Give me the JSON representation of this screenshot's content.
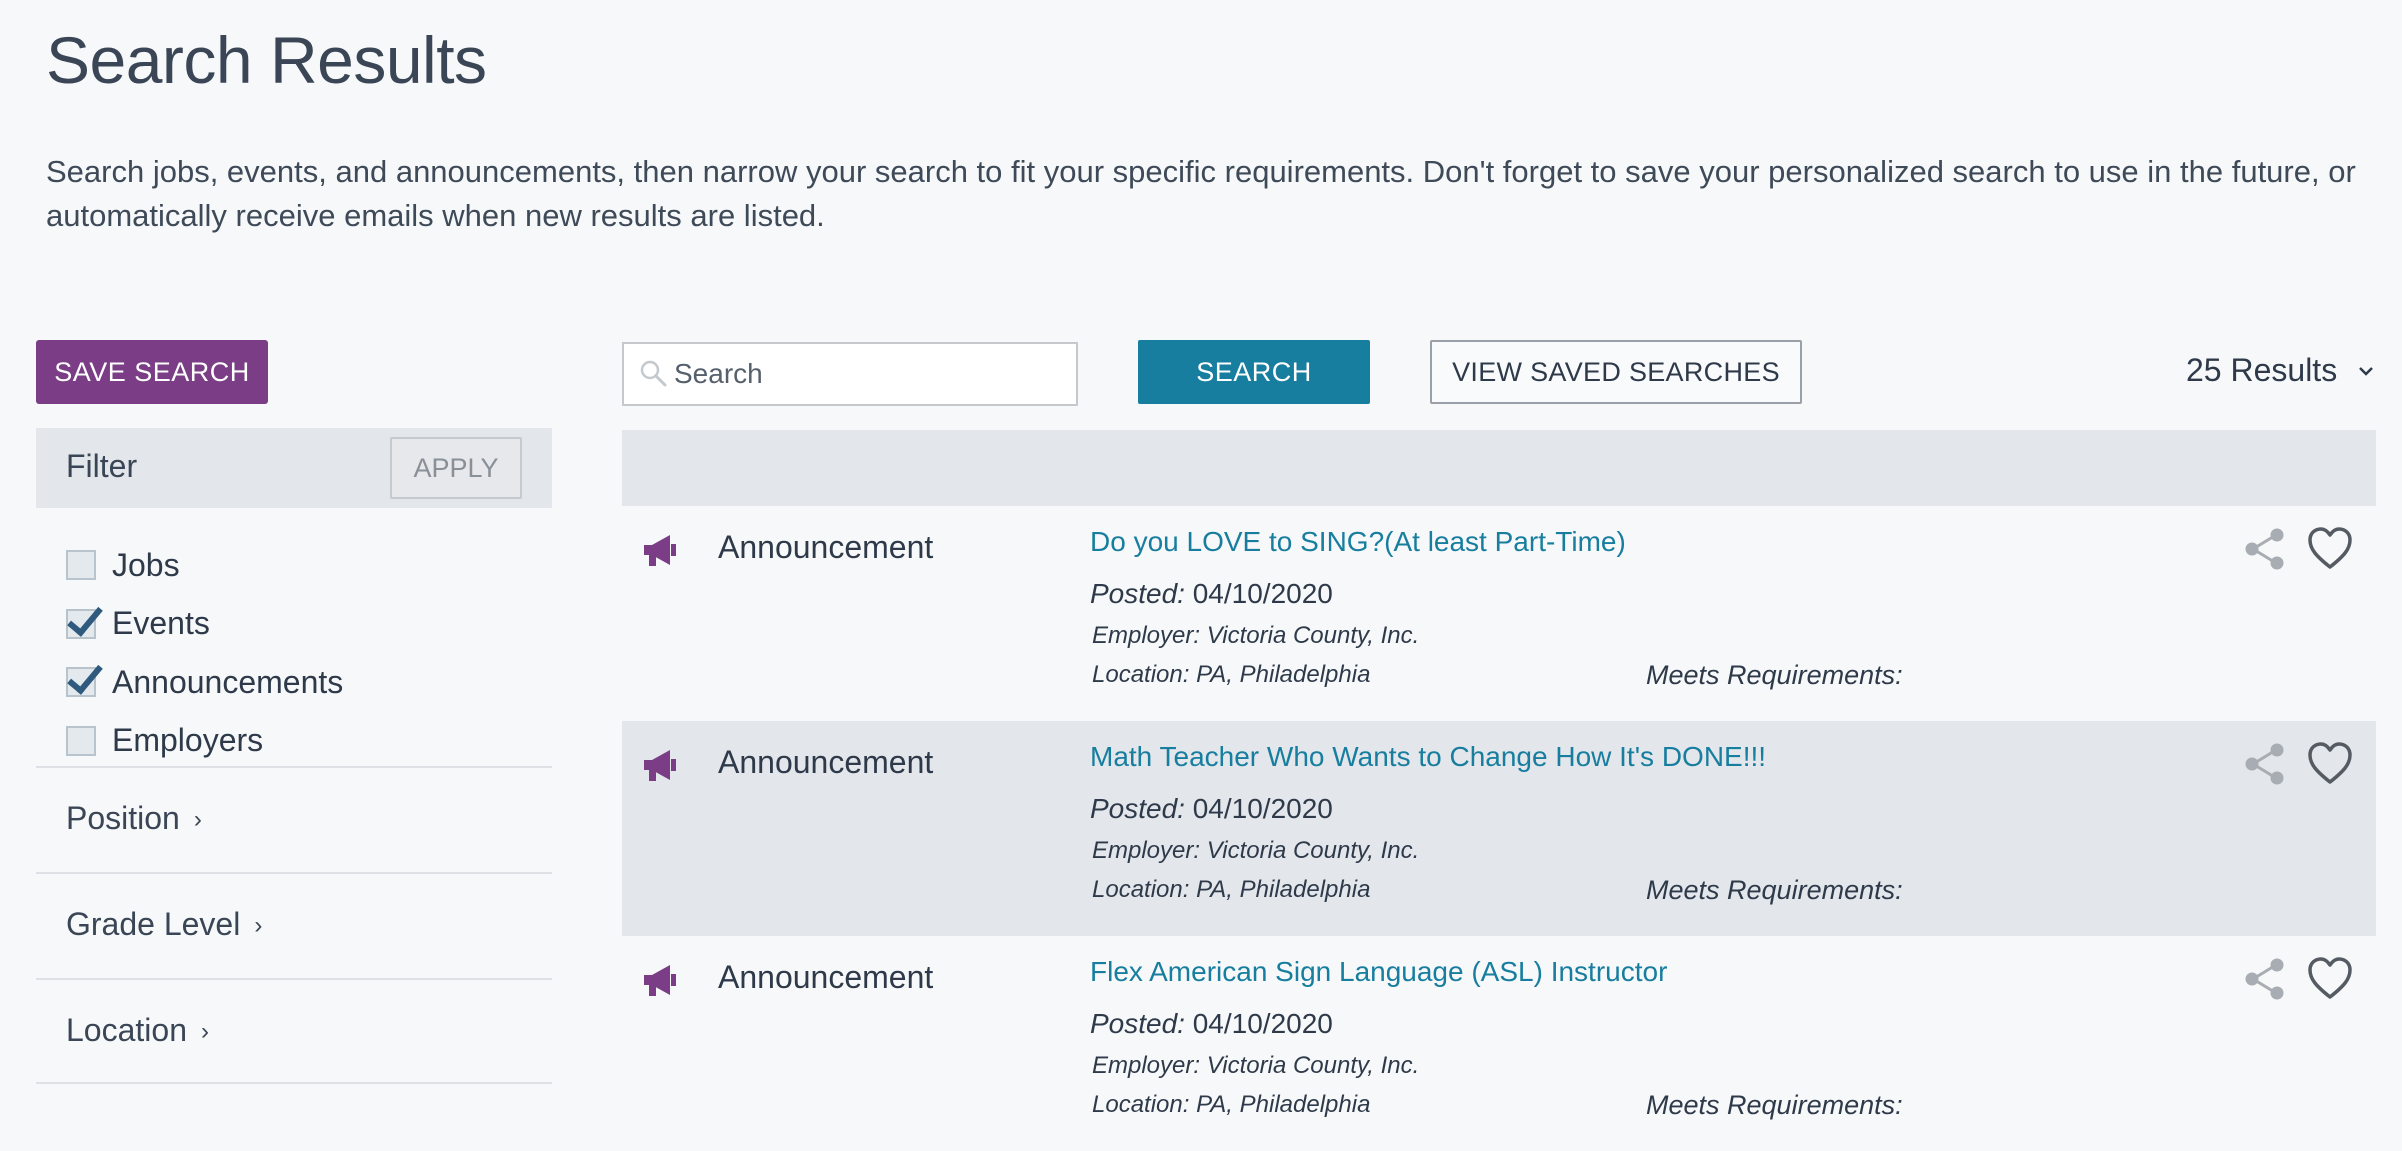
{
  "page": {
    "title": "Search Results",
    "intro": "Search jobs, events, and announcements, then narrow your search to fit your specific requirements. Don't forget to save your personalized search to use in the future, or automatically receive emails when new results are listed."
  },
  "toolbar": {
    "save_search_label": "SAVE SEARCH",
    "search_placeholder": "Search",
    "search_value": "",
    "search_button_label": "SEARCH",
    "view_saved_label": "VIEW SAVED SEARCHES",
    "results_count": "25 Results"
  },
  "filter": {
    "title": "Filter",
    "apply_label": "APPLY",
    "types": [
      {
        "label": "Jobs",
        "checked": false
      },
      {
        "label": "Events",
        "checked": true
      },
      {
        "label": "Announcements",
        "checked": true
      },
      {
        "label": "Employers",
        "checked": false
      }
    ],
    "facets": [
      {
        "label": "Position"
      },
      {
        "label": "Grade Level"
      },
      {
        "label": "Location"
      }
    ]
  },
  "results": [
    {
      "type": "Announcement",
      "title": "Do you LOVE to SING?(At least Part-Time)",
      "posted_label": "Posted:",
      "posted_date": "04/10/2020",
      "employer": "Employer: Victoria County, Inc.",
      "location": "Location: PA, Philadelphia",
      "meets": "Meets Requirements:"
    },
    {
      "type": "Announcement",
      "title": "Math Teacher Who Wants to Change How It's DONE!!!",
      "posted_label": "Posted:",
      "posted_date": "04/10/2020",
      "employer": "Employer: Victoria County, Inc.",
      "location": "Location: PA, Philadelphia",
      "meets": "Meets Requirements:"
    },
    {
      "type": "Announcement",
      "title": "Flex American Sign Language (ASL) Instructor",
      "posted_label": "Posted:",
      "posted_date": "04/10/2020",
      "employer": "Employer: Victoria County, Inc.",
      "location": "Location: PA, Philadelphia",
      "meets": "Meets Requirements:"
    }
  ],
  "icons": {
    "result_type": "megaphone-icon",
    "share": "share-icon",
    "favorite": "heart-icon",
    "search": "search-icon",
    "results_menu": "chevron-down-icon",
    "facet_expand": "chevron-right-icon"
  },
  "colors": {
    "brand_purple": "#7a3d86",
    "accent_teal": "#177e9f",
    "panel_gray": "#e3e6ea"
  }
}
